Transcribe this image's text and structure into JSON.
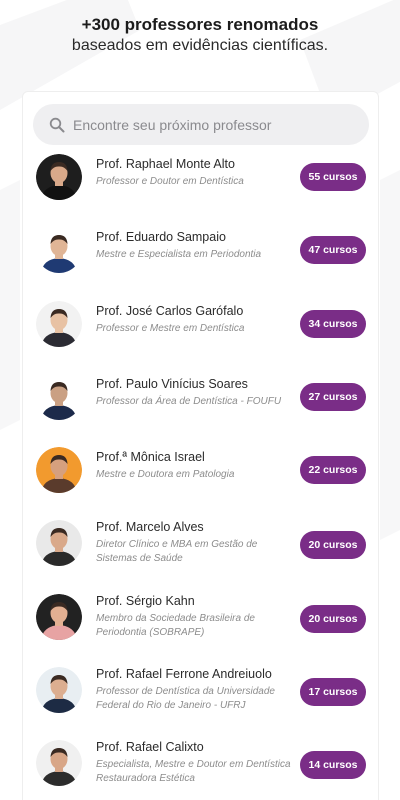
{
  "hero": {
    "title": "+300 professores renomados",
    "subtitle": "baseados em evidências científicas."
  },
  "search": {
    "placeholder": "Encontre seu próximo professor",
    "icon": "search-icon"
  },
  "colors": {
    "accent": "#7a2d87",
    "search_bg": "#efeff1"
  },
  "professors": [
    {
      "name": "Prof. Raphael Monte Alto",
      "desc": "Professor e Doutor em Dentística",
      "courses": "55 cursos",
      "avatar_bg": "#1e1e1e",
      "skin": "#d9a98a",
      "shirt": "#111111"
    },
    {
      "name": "Prof. Eduardo Sampaio",
      "desc": "Mestre e Especialista em Periodontia",
      "courses": "47 cursos",
      "avatar_bg": "#ffffff",
      "skin": "#e0b596",
      "shirt": "#1f3a73"
    },
    {
      "name": "Prof. José Carlos Garófalo",
      "desc": "Professor e Mestre em Dentística",
      "courses": "34 cursos",
      "avatar_bg": "#f2f2f2",
      "skin": "#e8c2a4",
      "shirt": "#2b2b33"
    },
    {
      "name": "Prof. Paulo Vinícius Soares",
      "desc": "Professor da Área de Dentística - FOUFU",
      "courses": "27 cursos",
      "avatar_bg": "#ffffff",
      "skin": "#caa083",
      "shirt": "#1c2a4a"
    },
    {
      "name": "Prof.ª Mônica Israel",
      "desc": "Mestre e Doutora em Patologia",
      "courses": "22 cursos",
      "avatar_bg": "#f29a2e",
      "skin": "#d6a07e",
      "shirt": "#5a3b2c"
    },
    {
      "name": "Prof. Marcelo Alves",
      "desc": "Diretor Clínico e MBA em Gestão de Sistemas de Saúde",
      "courses": "20 cursos",
      "avatar_bg": "#e9e9e9",
      "skin": "#d9a98a",
      "shirt": "#2a2a2a"
    },
    {
      "name": "Prof. Sérgio Kahn",
      "desc": "Membro da Sociedade Brasileira de Periodontia (SOBRAPE)",
      "courses": "20 cursos",
      "avatar_bg": "#222222",
      "skin": "#e3b092",
      "shirt": "#e7a3a3"
    },
    {
      "name": "Prof. Rafael Ferrone Andreiuolo",
      "desc": "Professor de Dentística da Universidade Federal do Rio de Janeiro - UFRJ",
      "courses": "17 cursos",
      "avatar_bg": "#e8eef2",
      "skin": "#dcae90",
      "shirt": "#1d2b44"
    },
    {
      "name": "Prof. Rafael Calixto",
      "desc": "Especialista, Mestre e Doutor em Dentística Restauradora Estética",
      "courses": "14 cursos",
      "avatar_bg": "#f0f0f0",
      "skin": "#d8a687",
      "shirt": "#2c2c2c"
    }
  ]
}
